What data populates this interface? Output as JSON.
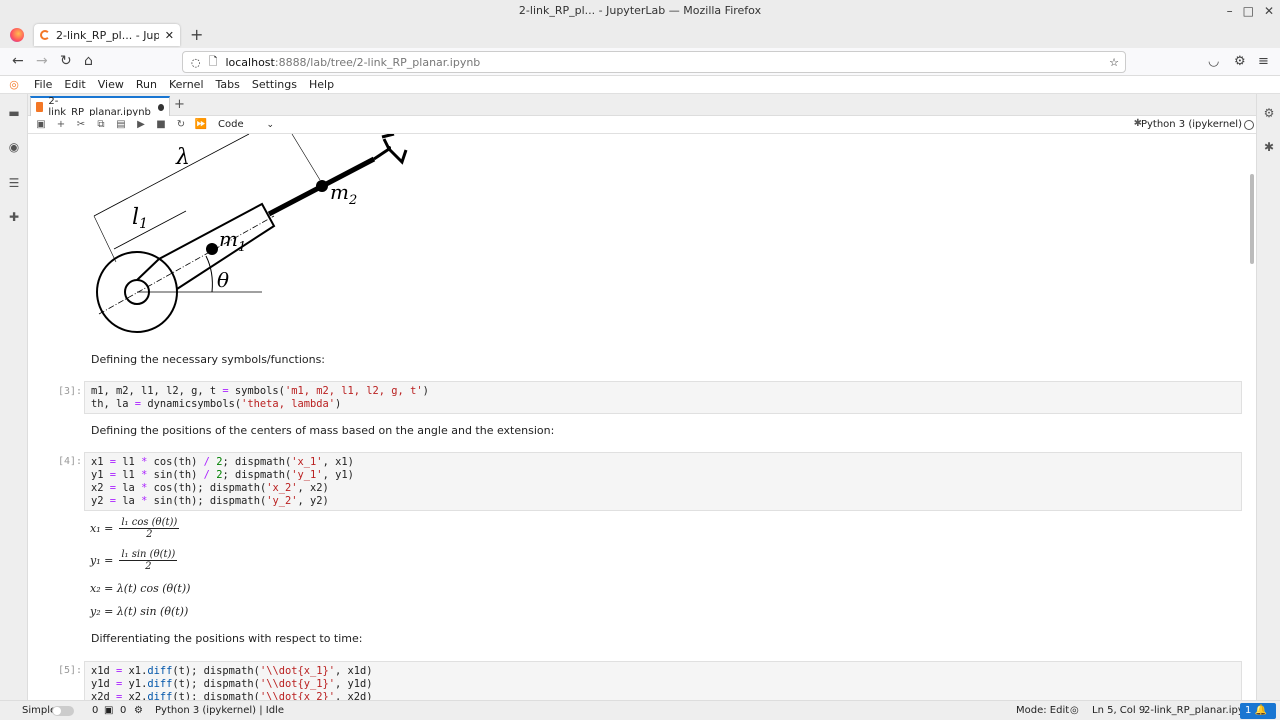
{
  "browser": {
    "window_title": "2-link_RP_pl... - JupyterLab — Mozilla Firefox",
    "tab_title": "2-link_RP_pl... - JupyterLab",
    "url_host": "localhost",
    "url_path": ":8888/lab/tree/2-link_RP_planar.ipynb"
  },
  "menu": [
    "File",
    "Edit",
    "View",
    "Run",
    "Kernel",
    "Tabs",
    "Settings",
    "Help"
  ],
  "doc_tab": {
    "title": "2-link_RP_planar.ipynb"
  },
  "toolbar": {
    "cell_type": "Code",
    "kernel": "Python 3 (ipykernel)"
  },
  "figure": {
    "label_lambda": "λ",
    "label_l1": "l",
    "label_l1_sub": "1",
    "label_m1": "m",
    "label_m1_sub": "1",
    "label_m2": "m",
    "label_m2_sub": "2",
    "label_theta": "θ"
  },
  "cells": {
    "md1": "Defining the necessary symbols/functions:",
    "p3": "[3]:",
    "md2": "Defining the positions of the centers of mass based on the angle and the extension:",
    "p4": "[4]:",
    "md3": "Differentiating the positions with respect to time:",
    "p5": "[5]:"
  },
  "math": {
    "x1_lhs": "x₁ =",
    "x1_num": "l₁ cos (θ(t))",
    "x1_den": "2",
    "y1_lhs": "y₁ =",
    "y1_num": "l₁ sin (θ(t))",
    "y1_den": "2",
    "x2": "x₂ = λ(t) cos (θ(t))",
    "y2": "y₂ = λ(t) sin (θ(t))"
  },
  "status": {
    "mode_simple": "Simple",
    "count_a": "0",
    "count_b": "0",
    "kernel_status": "Python 3 (ipykernel) | Idle",
    "mode": "Mode: Edit",
    "cursor": "Ln 5, Col 9",
    "file": "2-link_RP_planar.ipynb",
    "notif_count": "1"
  },
  "colors": {
    "accent": "#1976d2",
    "jupyter_orange": "#f37726"
  }
}
